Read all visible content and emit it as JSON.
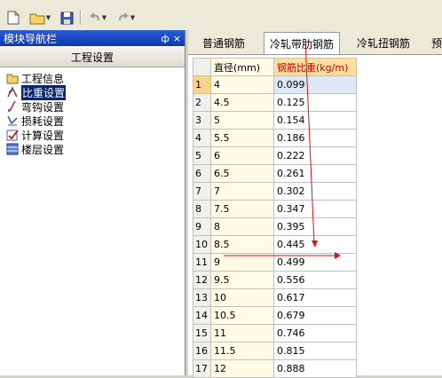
{
  "nav": {
    "title": "模块导航栏",
    "pin": "ф",
    "close": "×",
    "header": "工程设置",
    "items": [
      {
        "label": "工程信息",
        "icon": "folder-info-icon"
      },
      {
        "label": "比重设置",
        "icon": "weight-icon"
      },
      {
        "label": "弯钩设置",
        "icon": "hook-icon"
      },
      {
        "label": "损耗设置",
        "icon": "loss-icon"
      },
      {
        "label": "计算设置",
        "icon": "calc-icon"
      },
      {
        "label": "楼层设置",
        "icon": "floor-icon"
      }
    ]
  },
  "tabs": [
    "普通钢筋",
    "冷轧带肋钢筋",
    "冷轧扭钢筋",
    "预"
  ],
  "table": {
    "headers": [
      "直径(mm)",
      "钢筋比重(kg/m)"
    ],
    "rows": [
      {
        "n": "1",
        "d": "4",
        "w": "0.099"
      },
      {
        "n": "2",
        "d": "4.5",
        "w": "0.125"
      },
      {
        "n": "3",
        "d": "5",
        "w": "0.154"
      },
      {
        "n": "4",
        "d": "5.5",
        "w": "0.186"
      },
      {
        "n": "5",
        "d": "6",
        "w": "0.222"
      },
      {
        "n": "6",
        "d": "6.5",
        "w": "0.261"
      },
      {
        "n": "7",
        "d": "7",
        "w": "0.302"
      },
      {
        "n": "8",
        "d": "7.5",
        "w": "0.347"
      },
      {
        "n": "9",
        "d": "8",
        "w": "0.395"
      },
      {
        "n": "10",
        "d": "8.5",
        "w": "0.445"
      },
      {
        "n": "11",
        "d": "9",
        "w": "0.499"
      },
      {
        "n": "12",
        "d": "9.5",
        "w": "0.556"
      },
      {
        "n": "13",
        "d": "10",
        "w": "0.617"
      },
      {
        "n": "14",
        "d": "10.5",
        "w": "0.679"
      },
      {
        "n": "15",
        "d": "11",
        "w": "0.746"
      },
      {
        "n": "16",
        "d": "11.5",
        "w": "0.815"
      },
      {
        "n": "17",
        "d": "12",
        "w": "0.888"
      }
    ]
  },
  "annotation_color": "#e01010",
  "toolbar": {
    "icons": [
      "new-file-icon",
      "open-folder-icon",
      "save-icon",
      "undo-icon",
      "redo-icon"
    ]
  }
}
